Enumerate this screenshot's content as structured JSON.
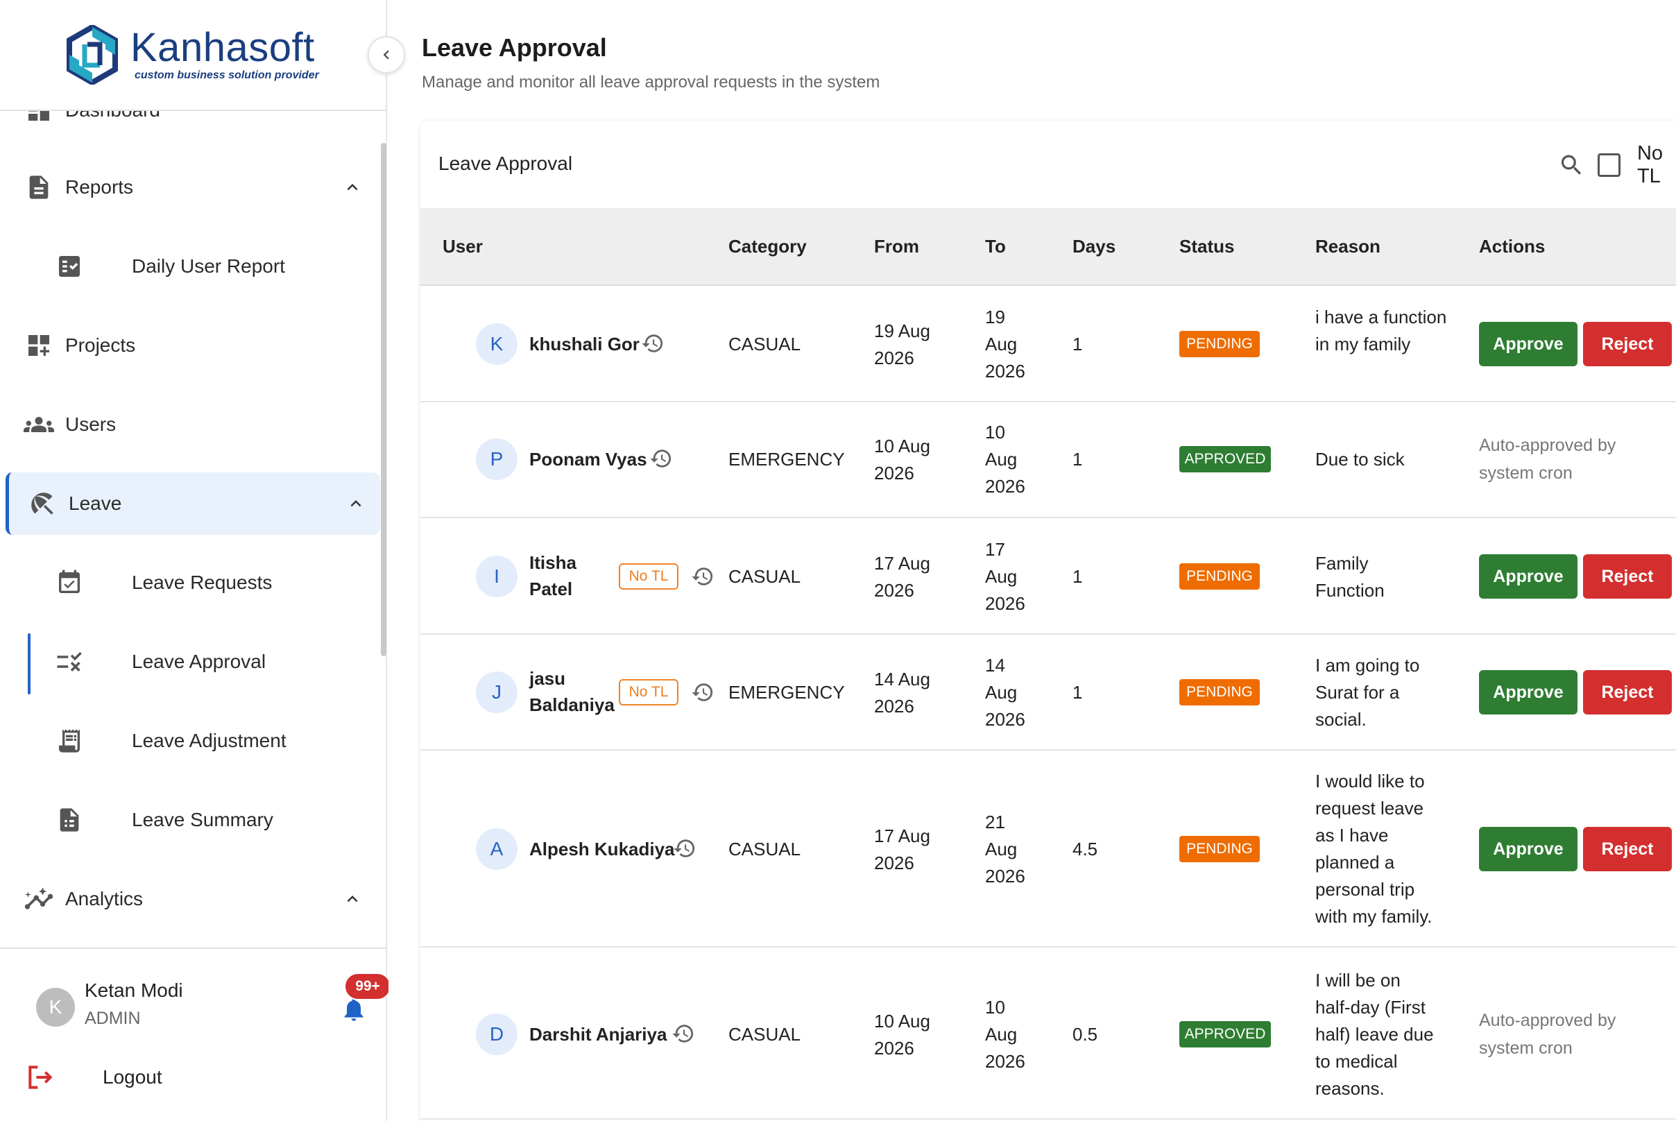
{
  "brand": {
    "name": "Kanhasoft",
    "tagline": "custom business solution provider"
  },
  "sidebar": {
    "partial_item": "Dashboard",
    "items": [
      {
        "label": "Reports",
        "icon": "document-icon"
      },
      {
        "label": "Daily User Report",
        "icon": "checklist-icon"
      },
      {
        "label": "Projects",
        "icon": "dashboard-add-icon"
      },
      {
        "label": "Users",
        "icon": "group-icon"
      },
      {
        "label": "Leave",
        "icon": "beach-umbrella-icon"
      },
      {
        "label": "Leave Requests",
        "icon": "calendar-check-icon"
      },
      {
        "label": "Leave Approval",
        "icon": "rule-icon"
      },
      {
        "label": "Leave Adjustment",
        "icon": "receipt-icon"
      },
      {
        "label": "Leave Summary",
        "icon": "summary-doc-icon"
      },
      {
        "label": "Analytics",
        "icon": "analytics-icon"
      }
    ],
    "user": {
      "initial": "K",
      "name": "Ketan Modi",
      "role": "ADMIN"
    },
    "notifications": "99+",
    "logout": "Logout"
  },
  "page": {
    "title": "Leave Approval",
    "subtitle": "Manage and monitor all leave approval requests in the system"
  },
  "card": {
    "title": "Leave Approval",
    "filter_label": "No TL"
  },
  "table": {
    "columns": [
      "User",
      "Category",
      "From",
      "To",
      "Days",
      "Status",
      "Reason",
      "Actions"
    ],
    "rows": [
      {
        "initial": "K",
        "user": "khushali Gor",
        "no_tl": "",
        "category": "CASUAL",
        "from": "19 Aug 2026",
        "to": "19 Aug 2026",
        "days": "1",
        "status": "PENDING",
        "reason": "i have a function in my family",
        "approve": "Approve",
        "reject": "Reject",
        "auto_note": ""
      },
      {
        "initial": "P",
        "user": "Poonam Vyas",
        "no_tl": "",
        "category": "EMERGENCY",
        "from": "10 Aug 2026",
        "to": "10 Aug 2026",
        "days": "1",
        "status": "APPROVED",
        "reason": "Due to sick",
        "approve": "",
        "reject": "",
        "auto_note": "Auto-approved by system cron"
      },
      {
        "initial": "I",
        "user": "Itisha Patel",
        "no_tl": "No TL",
        "category": "CASUAL",
        "from": "17 Aug 2026",
        "to": "17 Aug 2026",
        "days": "1",
        "status": "PENDING",
        "reason": "Family Function",
        "approve": "Approve",
        "reject": "Reject",
        "auto_note": ""
      },
      {
        "initial": "J",
        "user": "jasu Baldaniya",
        "no_tl": "No TL",
        "category": "EMERGENCY",
        "from": "14 Aug 2026",
        "to": "14 Aug 2026",
        "days": "1",
        "status": "PENDING",
        "reason": "I am going to Surat for a social.",
        "approve": "Approve",
        "reject": "Reject",
        "auto_note": ""
      },
      {
        "initial": "A",
        "user": "Alpesh Kukadiya",
        "no_tl": "",
        "category": "CASUAL",
        "from": "17 Aug 2026",
        "to": "21 Aug 2026",
        "days": "4.5",
        "status": "PENDING",
        "reason": "I would like to request leave as I have planned a personal trip with my family.",
        "approve": "Approve",
        "reject": "Reject",
        "auto_note": ""
      },
      {
        "initial": "D",
        "user": "Darshit Anjariya",
        "no_tl": "",
        "category": "CASUAL",
        "from": "10 Aug 2026",
        "to": "10 Aug 2026",
        "days": "0.5",
        "status": "APPROVED",
        "reason": "I will be on half-day (First half) leave due to medical reasons.",
        "approve": "",
        "reject": "",
        "auto_note": "Auto-approved by system cron"
      }
    ]
  },
  "colors": {
    "accent": "#1f63c6",
    "pending": "#ef6c00",
    "approved": "#2e7d32",
    "reject": "#d32f2f",
    "brand": "#1a3f80"
  }
}
